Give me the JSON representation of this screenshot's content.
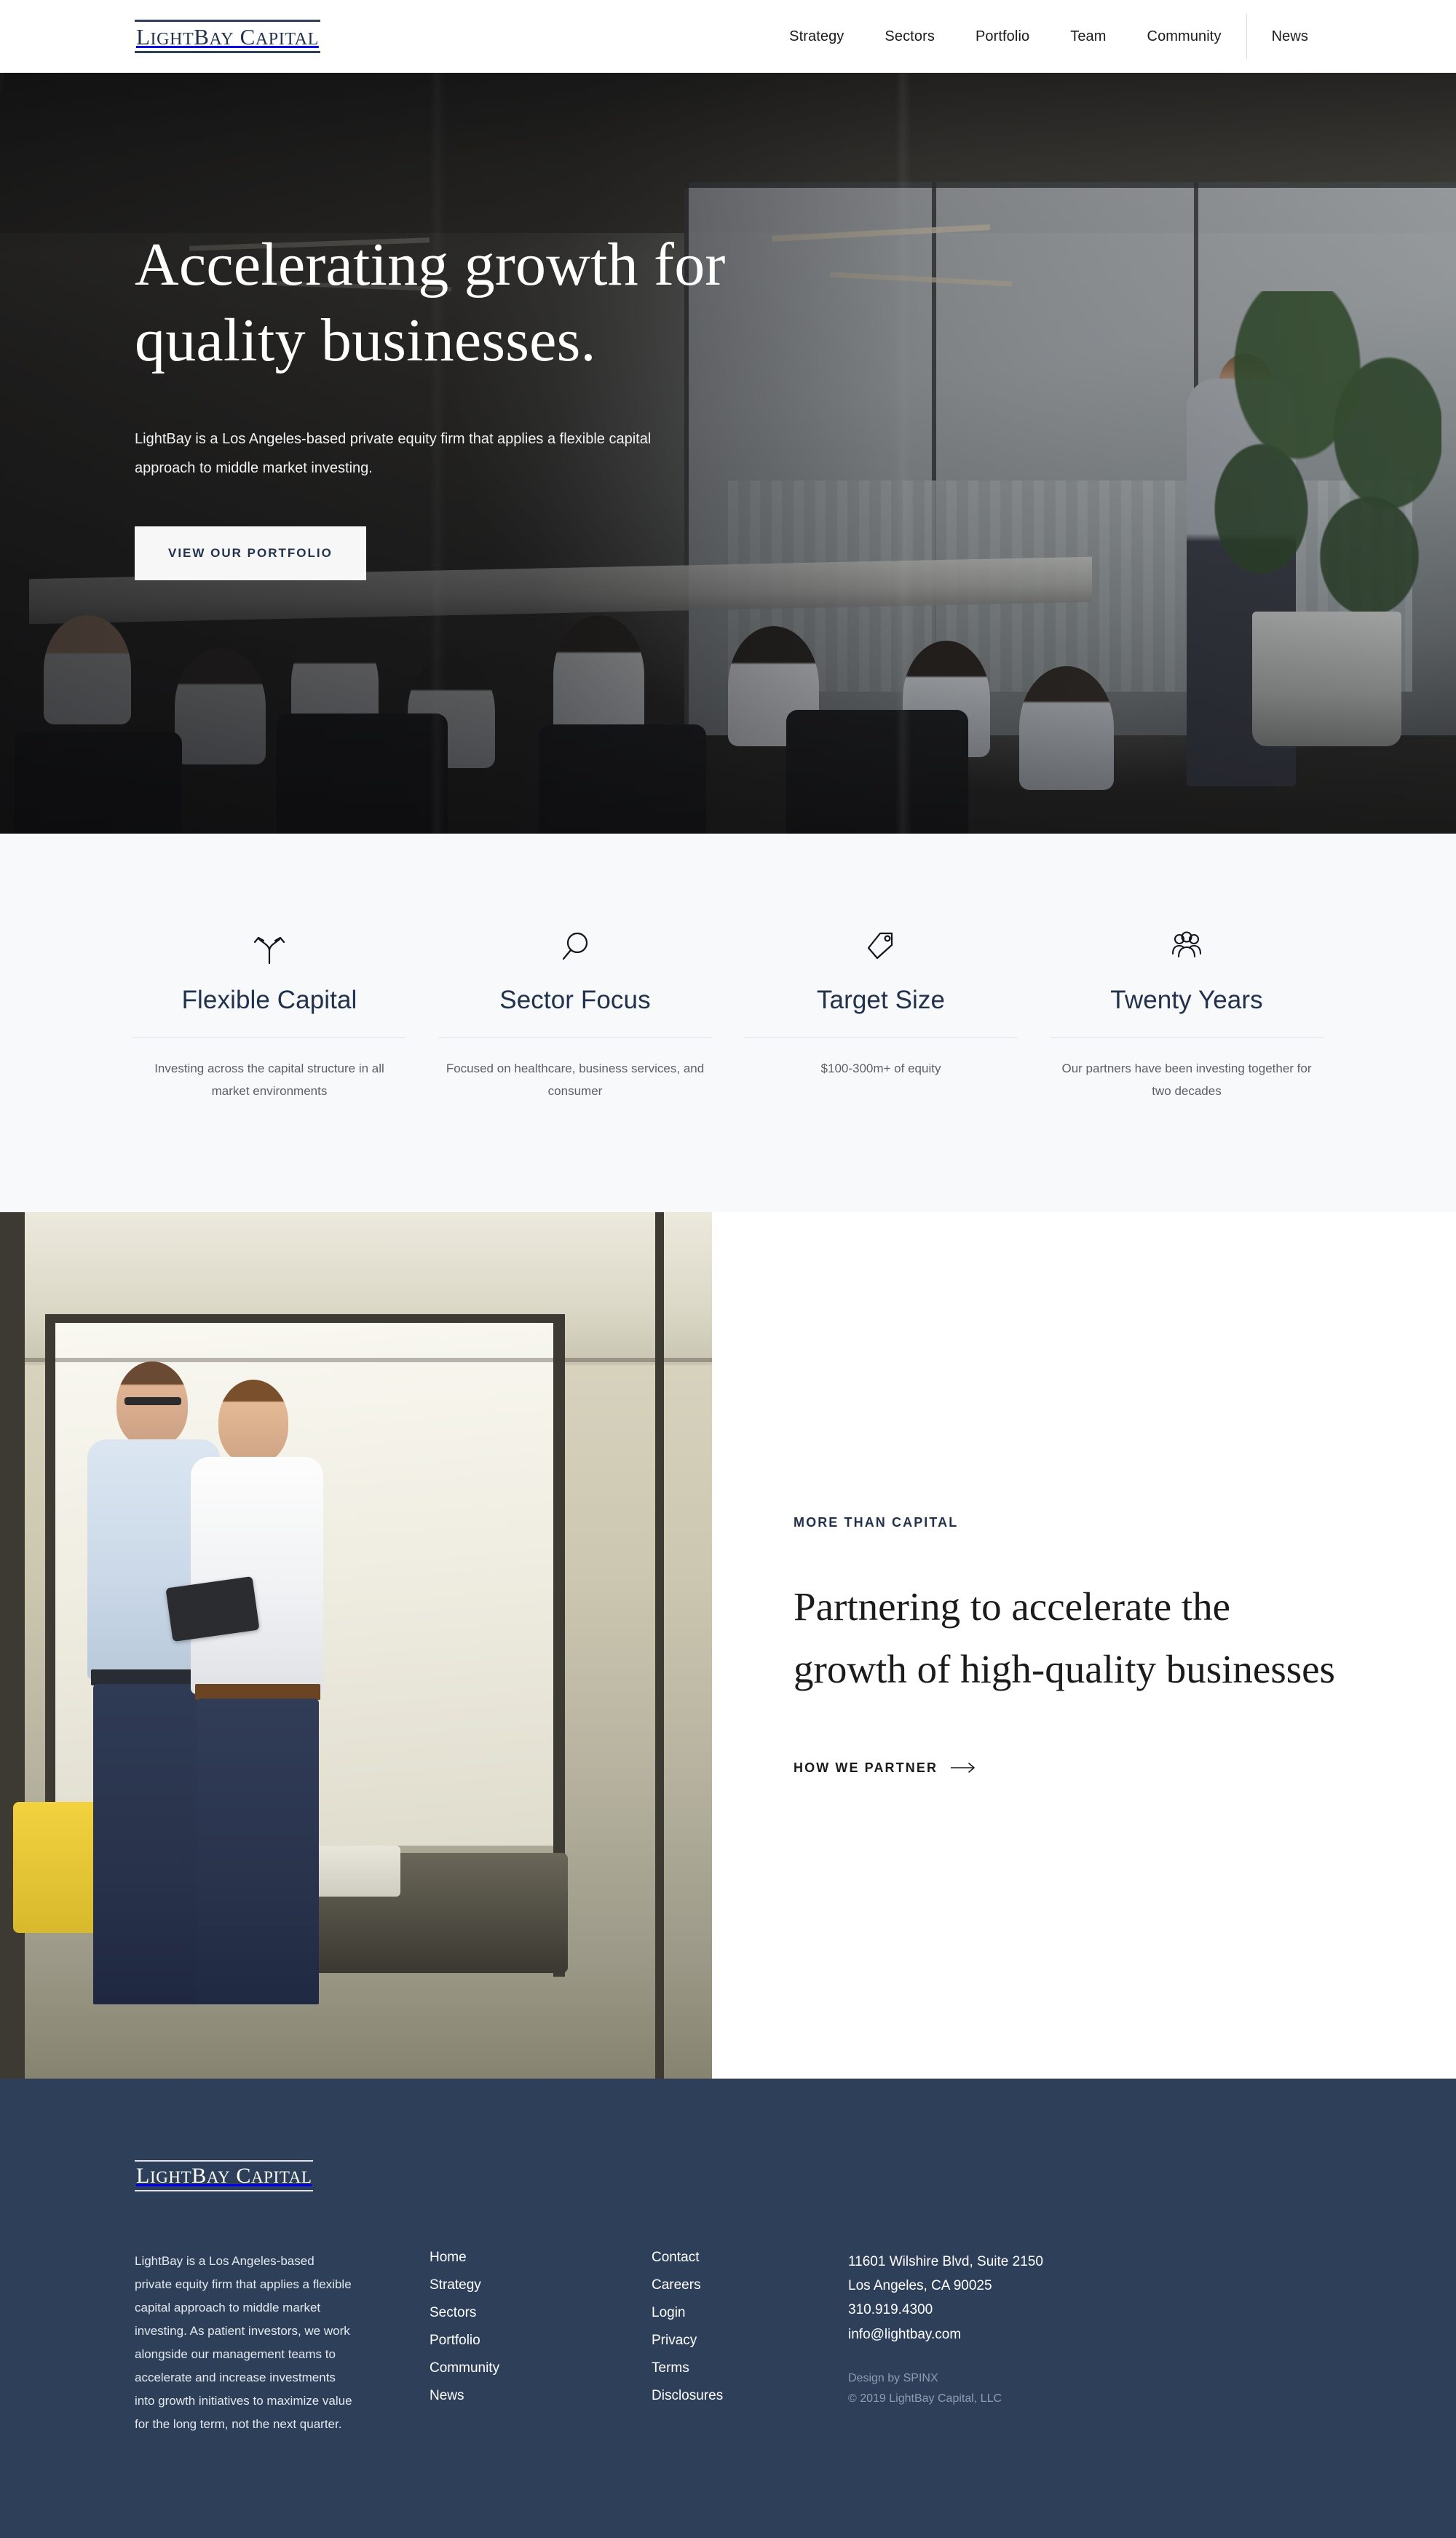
{
  "brand": {
    "logo_word1_cap": "L",
    "logo_word1_rest": "IGHT",
    "logo_word2_cap": "B",
    "logo_word2_rest": "AY",
    "logo_word3_cap": "C",
    "logo_word3_rest": "APITAL",
    "logo_full": "LightBay Capital",
    "accent_navy": "#2e4059",
    "text_navy": "#22314c",
    "features_bg": "#f8f9fb"
  },
  "nav": {
    "items": [
      {
        "label": "Strategy"
      },
      {
        "label": "Sectors"
      },
      {
        "label": "Portfolio"
      },
      {
        "label": "Team"
      },
      {
        "label": "Community"
      },
      {
        "label": "News"
      }
    ]
  },
  "hero": {
    "title": "Accelerating growth for quality businesses.",
    "subtitle": "LightBay is a Los Angeles-based private equity firm that applies a flexible capital approach to middle market investing.",
    "cta_label": "VIEW OUR PORTFOLIO"
  },
  "features": [
    {
      "icon": "branching-arrows-icon",
      "title": "Flexible Capital",
      "description": "Investing across the capital structure in all market environments"
    },
    {
      "icon": "magnifier-icon",
      "title": "Sector Focus",
      "description": "Focused on healthcare, business services, and consumer"
    },
    {
      "icon": "price-tag-icon",
      "title": "Target Size",
      "description": "$100-300m+ of equity"
    },
    {
      "icon": "people-group-icon",
      "title": "Twenty Years",
      "description": "Our partners have been investing together for two decades"
    }
  ],
  "partner": {
    "eyebrow": "MORE THAN CAPITAL",
    "title": "Partnering to accelerate the growth of high-quality businesses",
    "link_label": "HOW WE PARTNER"
  },
  "footer": {
    "about": "LightBay is a Los Angeles-based private equity firm that applies a flexible capital approach to middle market investing. As patient investors, we work alongside our management teams to accelerate and increase investments into growth initiatives to maximize value for the long term, not the next quarter.",
    "nav_primary": [
      {
        "label": "Home"
      },
      {
        "label": "Strategy"
      },
      {
        "label": "Sectors"
      },
      {
        "label": "Portfolio"
      },
      {
        "label": "Community"
      },
      {
        "label": "News"
      }
    ],
    "nav_secondary": [
      {
        "label": "Contact"
      },
      {
        "label": "Careers"
      },
      {
        "label": "Login"
      },
      {
        "label": "Privacy"
      },
      {
        "label": "Terms"
      },
      {
        "label": "Disclosures"
      }
    ],
    "contact": {
      "address_line1": "11601 Wilshire Blvd, Suite 2150",
      "address_line2": "Los Angeles, CA 90025",
      "phone": "310.919.4300",
      "email": "info@lightbay.com"
    },
    "credits": {
      "design": "Design by SPINX",
      "copyright": "© 2019 LightBay Capital, LLC"
    }
  }
}
